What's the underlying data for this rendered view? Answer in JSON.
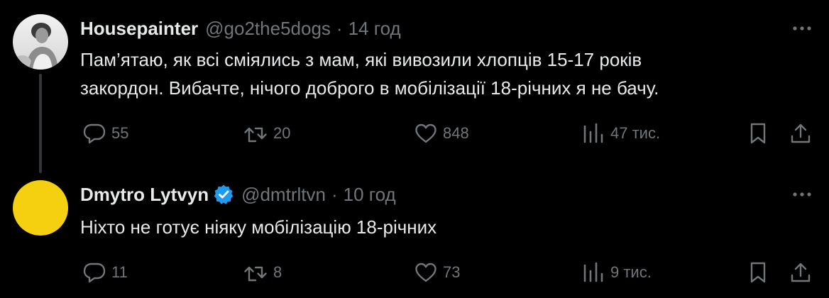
{
  "tweets": [
    {
      "display_name": "Housepainter",
      "handle": "@go2the5dogs",
      "separator": "·",
      "time": "14 год",
      "verified": false,
      "text": "Пам’ятаю, як всі сміялись з мам, які вивозили хлопців 15-17 років\nзакордон. Вибачте, нічого доброго в мобілізації 18-річних я не бачу.",
      "replies": "55",
      "reposts": "20",
      "likes": "848",
      "views": "47 тис."
    },
    {
      "display_name": "Dmytro Lytvyn",
      "handle": "@dmtrltvn",
      "separator": "·",
      "time": "10 год",
      "verified": true,
      "text": "Ніхто не готує ніяку мобілізацію 18-річних",
      "replies": "11",
      "reposts": "8",
      "likes": "73",
      "views": "9 тис."
    }
  ],
  "icons": {
    "more": "more-horizontal-icon",
    "reply": "speech-bubble-icon",
    "repost": "repost-arrows-icon",
    "like": "heart-icon",
    "views": "bar-chart-icon",
    "bookmark": "bookmark-icon",
    "share": "share-upload-icon",
    "verified": "verified-badge-icon"
  },
  "colors": {
    "background": "#000000",
    "text_primary": "#e7e9ea",
    "text_secondary": "#71767b",
    "thread_line": "#333639",
    "verified_blue": "#1d9bf0",
    "avatar_2_yellow": "#f5d010"
  }
}
